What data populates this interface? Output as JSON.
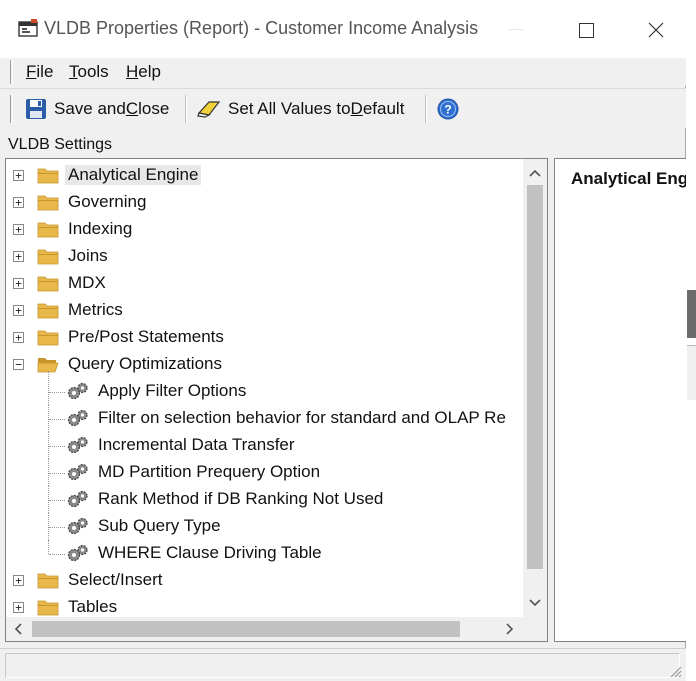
{
  "window": {
    "title": "VLDB Properties (Report) - Customer Income Analysis",
    "controls": {
      "minimize": "—",
      "maximize": "☐",
      "close": "✕"
    }
  },
  "menu": {
    "file": {
      "accel": "F",
      "rest": "ile"
    },
    "tools": {
      "accel": "T",
      "rest": "ools"
    },
    "help": {
      "accel": "H",
      "rest": "elp"
    }
  },
  "toolbar": {
    "save_close": {
      "pre": "Save and ",
      "accel": "C",
      "post": "lose"
    },
    "set_default": {
      "pre": "Set All Values to ",
      "accel": "D",
      "post": "efault"
    },
    "help_icon": "help-icon"
  },
  "section_label": "VLDB Settings",
  "tree": {
    "folders_top": [
      {
        "label": "Analytical Engine",
        "expander": "+",
        "selected": true
      },
      {
        "label": "Governing",
        "expander": "+"
      },
      {
        "label": "Indexing",
        "expander": "+"
      },
      {
        "label": "Joins",
        "expander": "+"
      },
      {
        "label": "MDX",
        "expander": "+"
      },
      {
        "label": "Metrics",
        "expander": "+"
      },
      {
        "label": "Pre/Post Statements",
        "expander": "+"
      }
    ],
    "expanded_folder": {
      "label": "Query Optimizations",
      "expander": "−"
    },
    "children": [
      {
        "label": "Apply Filter Options"
      },
      {
        "label": "Filter on selection behavior for standard and OLAP Re"
      },
      {
        "label": "Incremental Data Transfer"
      },
      {
        "label": "MD Partition Prequery Option"
      },
      {
        "label": "Rank Method if DB Ranking Not Used"
      },
      {
        "label": "Sub Query Type"
      },
      {
        "label": "WHERE Clause Driving Table"
      }
    ],
    "folders_bottom": [
      {
        "label": "Select/Insert",
        "expander": "+"
      },
      {
        "label": "Tables",
        "expander": "+"
      }
    ]
  },
  "scroll": {
    "up": "⌃",
    "down": "⌄",
    "left": "‹",
    "right": "›"
  },
  "detail": {
    "title": "Analytical Eng"
  },
  "colors": {
    "folder": "#e8b84a",
    "folder_dark": "#c8952c",
    "help_blue": "#2f6fd0",
    "save_blue": "#2a5ca8"
  }
}
